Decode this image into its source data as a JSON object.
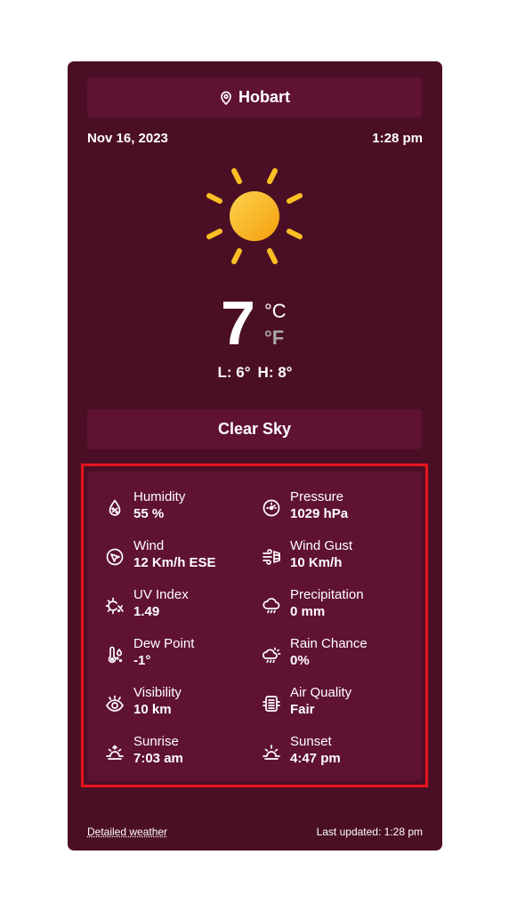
{
  "location": {
    "city": "Hobart"
  },
  "date": "Nov 16, 2023",
  "time": "1:28 pm",
  "current": {
    "icon": "sun-icon",
    "temperature": "7",
    "unit_c": "°C",
    "unit_f": "°F",
    "low": "L: 6°",
    "high": "H: 8°",
    "condition": "Clear Sky"
  },
  "details": [
    {
      "label": "Humidity",
      "value": "55 %",
      "icon": "humidity-icon"
    },
    {
      "label": "Pressure",
      "value": "1029 hPa",
      "icon": "pressure-icon"
    },
    {
      "label": "Wind",
      "value": "12 Km/h ESE",
      "icon": "wind-direction-icon"
    },
    {
      "label": "Wind Gust",
      "value": "10 Km/h",
      "icon": "wind-gust-icon"
    },
    {
      "label": "UV Index",
      "value": "1.49",
      "icon": "uv-index-icon"
    },
    {
      "label": "Precipitation",
      "value": "0 mm",
      "icon": "precipitation-icon"
    },
    {
      "label": "Dew Point",
      "value": "-1°",
      "icon": "dew-point-icon"
    },
    {
      "label": "Rain Chance",
      "value": "0%",
      "icon": "rain-chance-icon"
    },
    {
      "label": "Visibility",
      "value": "10 km",
      "icon": "visibility-icon"
    },
    {
      "label": "Air Quality",
      "value": "Fair",
      "icon": "air-quality-icon"
    },
    {
      "label": "Sunrise",
      "value": "7:03 am",
      "icon": "sunrise-icon"
    },
    {
      "label": "Sunset",
      "value": "4:47 pm",
      "icon": "sunset-icon"
    }
  ],
  "footer": {
    "detailed_link": "Detailed weather",
    "last_updated": "Last updated: 1:28 pm"
  },
  "colors": {
    "card_bg": "#4b0f25",
    "panel_bg": "#5f1232",
    "highlight_border": "#e8141c",
    "sun": "#fbbf24"
  }
}
